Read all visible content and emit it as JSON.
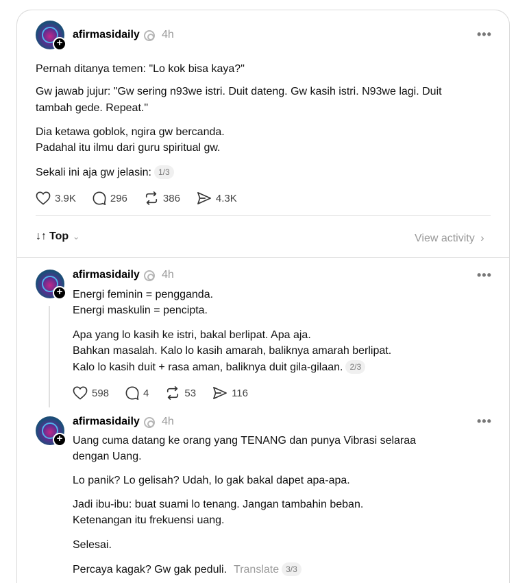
{
  "post": {
    "username": "afirmasidaily",
    "time": "4h",
    "lines": [
      "Pernah ditanya temen: \"Lo kok bisa kaya?\"",
      "Gw jawab jujur: \"Gw sering n93we istri. Duit dateng. Gw kasih istri. N93we lagi. Duit",
      "tambah gede. Repeat.\"",
      "Dia ketawa goblok, ngira gw bercanda.",
      "Padahal itu ilmu dari guru spiritual gw.",
      "Sekali ini aja gw jelasin:"
    ],
    "badge": "1/3",
    "likes": "3.9K",
    "replies": "296",
    "reposts": "386",
    "shares": "4.3K"
  },
  "sort": {
    "label": "Top",
    "view_activity": "View activity"
  },
  "reply1": {
    "username": "afirmasidaily",
    "time": "4h",
    "lines": [
      "Energi feminin = pengganda.",
      "Energi maskulin = pencipta.",
      "Apa yang lo kasih ke istri, bakal berlipat. Apa aja.",
      "Bahkan masalah. Kalo lo kasih amarah, baliknya amarah berlipat.",
      "Kalo lo kasih duit + rasa aman, baliknya duit gila-gilaan."
    ],
    "badge": "2/3",
    "likes": "598",
    "replies": "4",
    "reposts": "53",
    "shares": "116"
  },
  "reply2": {
    "username": "afirmasidaily",
    "time": "4h",
    "lines": [
      "Uang cuma datang ke orang yang TENANG dan punya Vibrasi selaraa",
      "dengan Uang.",
      "Lo panik? Lo gelisah? Udah, lo gak bakal dapet apa-apa.",
      "Jadi ibu-ibu: buat suami lo tenang. Jangan tambahin beban.",
      "Ketenangan itu frekuensi uang.",
      "Selesai.",
      "Percaya kagak? Gw gak peduli."
    ],
    "translate": "Translate",
    "badge": "3/3"
  },
  "icons": {
    "avatar": "avatar-image",
    "follow": "plus-icon",
    "replied": "threads-icon",
    "more": "more-horizontal-icon",
    "like": "heart-icon",
    "reply": "comment-icon",
    "repost": "repost-icon",
    "share": "send-icon",
    "sort": "sort-arrows-icon",
    "chevron": "chevron-down-icon",
    "chevron_right": "chevron-right-icon"
  }
}
